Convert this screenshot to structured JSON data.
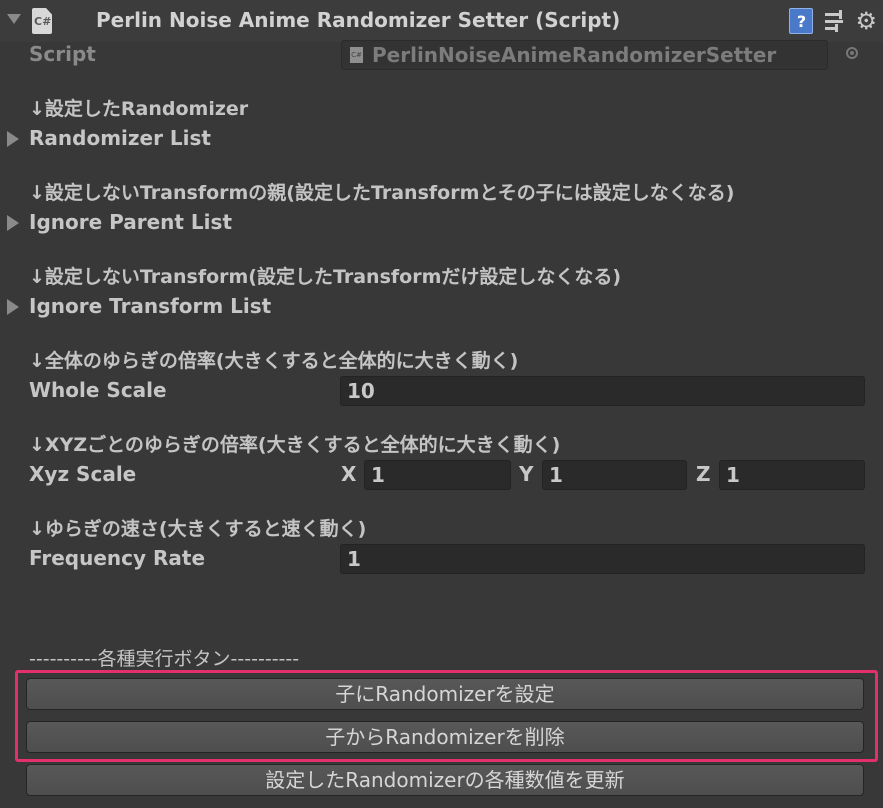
{
  "header": {
    "component_title": "Perlin Noise Anime Randomizer Setter (Script)",
    "cs_icon_text": "C#"
  },
  "script_row": {
    "label": "Script",
    "value": "PerlinNoiseAnimeRandomizerSetter",
    "icon_text": "C#"
  },
  "sections": {
    "randomizer_comment": "↓設定したRandomizer",
    "randomizer_list": "Randomizer List",
    "ignore_parent_comment": "↓設定しないTransformの親(設定したTransformとその子には設定しなくなる)",
    "ignore_parent_list": "Ignore Parent List",
    "ignore_transform_comment": "↓設定しないTransform(設定したTransformだけ設定しなくなる)",
    "ignore_transform_list": "Ignore Transform List",
    "whole_scale_comment": "↓全体のゆらぎの倍率(大きくすると全体的に大きく動く)",
    "whole_scale_label": "Whole Scale",
    "whole_scale_value": "10",
    "xyz_scale_comment": "↓XYZごとのゆらぎの倍率(大きくすると全体的に大きく動く)",
    "xyz_scale_label": "Xyz Scale",
    "x_label": "X",
    "x_value": "1",
    "y_label": "Y",
    "y_value": "1",
    "z_label": "Z",
    "z_value": "1",
    "frequency_comment": "↓ゆらぎの速さ(大きくすると速く動く)",
    "frequency_label": "Frequency Rate",
    "frequency_value": "1"
  },
  "buttons": {
    "separator": "----------各種実行ボタン----------",
    "set_randomizer": "子にRandomizerを設定",
    "remove_randomizer": "子からRandomizerを削除",
    "update_values": "設定したRandomizerの各種数値を更新"
  },
  "colors": {
    "background": "#383838",
    "highlight": "#e3306b",
    "help_icon": "#4a79c9"
  }
}
